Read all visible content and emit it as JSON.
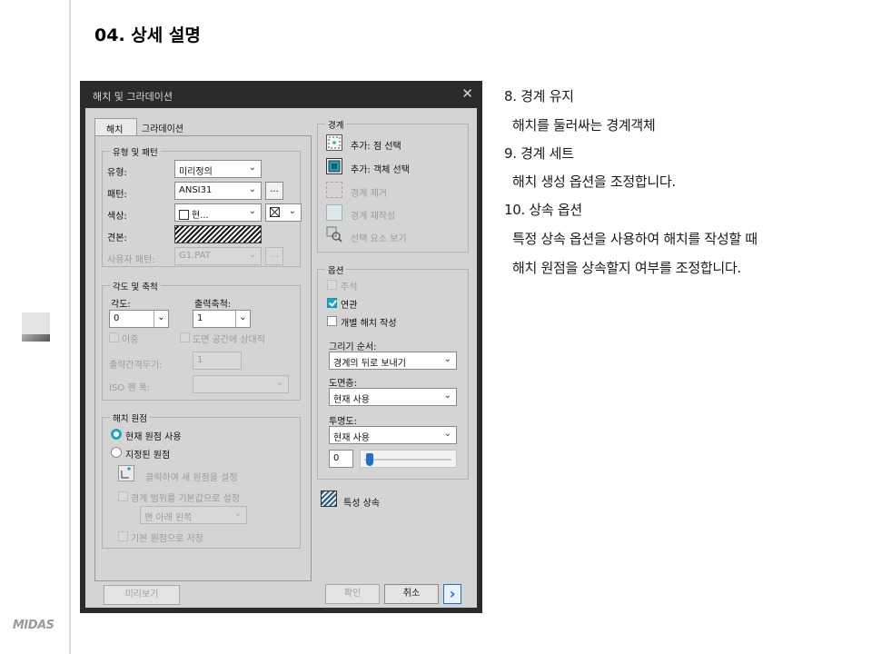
{
  "page": {
    "title": "04. 상세 설명",
    "brand": "MIDAS"
  },
  "dialog": {
    "title": "해치 및 그라데이션",
    "close_glyph": "✕",
    "tabs": [
      {
        "label": "해치"
      },
      {
        "label": "그라데이션"
      }
    ],
    "type_pattern": {
      "legend": "유형 및 패턴",
      "type_label": "유형:",
      "type_value": "미리정의",
      "pattern_label": "패턴:",
      "pattern_value": "ANSI31",
      "color_label": "색상:",
      "color_value": "현...",
      "swatch_label": "견본:",
      "custom_label": "사용자 패턴:",
      "custom_value": "G1.PAT",
      "ellipsis": "..."
    },
    "angle_scale": {
      "legend": "각도 및 축척",
      "angle_label": "각도:",
      "angle_value": "0",
      "scale_label": "출력축척:",
      "scale_value": "1",
      "double_label": "이중",
      "relative_label": "도면 공간에 상대적",
      "spacing_label": "출력간격두기:",
      "spacing_value": "1",
      "iso_label": "ISO 펜 폭:"
    },
    "origin": {
      "legend": "해치 원점",
      "current_label": "현재 원점 사용",
      "specified_label": "지정된 원점",
      "click_set_label": "클릭하여 새 원점을 설정",
      "default_boundary_label": "경계 범위를 기본값으로 설정",
      "position_value": "맨 아래 왼쪽",
      "store_default_label": "기본 원점으로 저장"
    },
    "boundaries": {
      "legend": "경계",
      "add_pick_label": "추가: 점 선택",
      "add_select_label": "추가: 객체 선택",
      "remove_label": "경계 제거",
      "recreate_label": "경계 재작성",
      "view_label": "선택 요소 보기"
    },
    "options": {
      "legend": "옵션",
      "annotative_label": "주석",
      "associative_label": "연관",
      "separate_label": "개별 해치 작성",
      "draw_order_label": "그리기 순서:",
      "draw_order_value": "경계의 뒤로 보내기",
      "layer_label": "도면층:",
      "layer_value": "현재 사용",
      "transparency_label": "투명도:",
      "transparency_value": "현재 사용",
      "transparency_amount": "0"
    },
    "inherit_label": "특성 상속",
    "preview_label": "미리보기",
    "ok_label": "확인",
    "cancel_label": "취소",
    "more_glyph": "›"
  },
  "explanation": [
    "8. 경계 유지",
    "해치를 둘러싸는 경계객체",
    "9. 경계 세트",
    "해치 생성 옵션을 조정합니다.",
    "10. 상속 옵션",
    "특정 상속 옵션을 사용하여 해치를 작성할 때",
    "해치 원점을 상속할지 여부를 조정합니다."
  ],
  "colors": {
    "dialog_frame": "#2b2b2b",
    "dialog_body": "#d4d4d4",
    "accent": "#1ba6c9",
    "accent_button": "#1e6fd0"
  }
}
